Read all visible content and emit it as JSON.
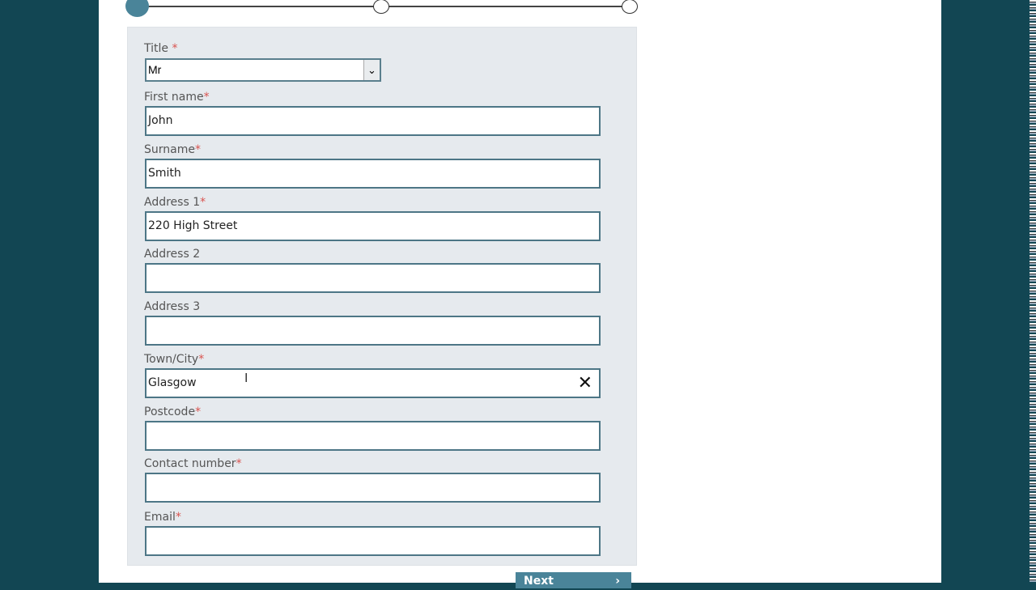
{
  "stepper": {
    "steps": 3,
    "current": 1
  },
  "form": {
    "title": {
      "label": "Title",
      "required": "*",
      "value": "Mr"
    },
    "fields": [
      {
        "label": "First name",
        "required": "*",
        "value": "John"
      },
      {
        "label": "Surname",
        "required": "*",
        "value": "Smith"
      },
      {
        "label": "Address 1",
        "required": "*",
        "value": "220 High Street"
      },
      {
        "label": "Address 2",
        "required": "",
        "value": ""
      },
      {
        "label": "Address 3",
        "required": "",
        "value": ""
      },
      {
        "label": "Town/City",
        "required": "*",
        "value": "Glasgow"
      },
      {
        "label": "Postcode",
        "required": "*",
        "value": ""
      },
      {
        "label": "Contact number",
        "required": "*",
        "value": ""
      },
      {
        "label": "Email",
        "required": "*",
        "value": ""
      }
    ]
  },
  "next_button": {
    "label": "Next",
    "icon": "chevron-right-icon"
  },
  "colors": {
    "accent": "#4a8499",
    "background": "#124653",
    "required": "#d9534f"
  }
}
